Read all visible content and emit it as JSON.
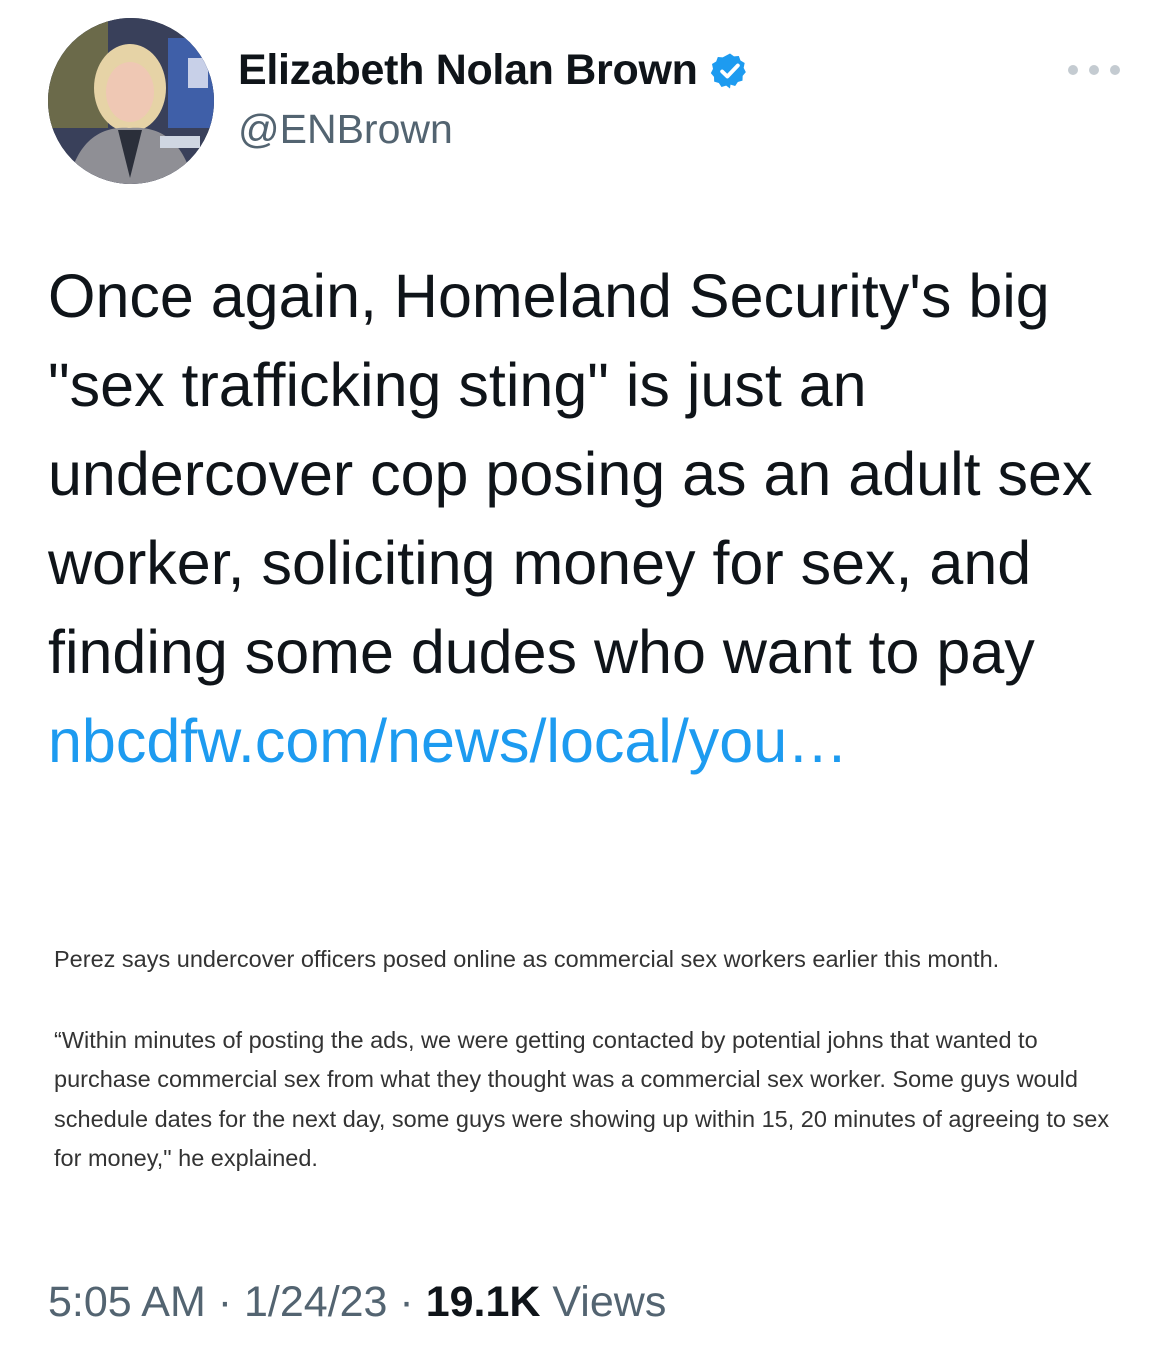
{
  "author": {
    "display_name": "Elizabeth Nolan Brown",
    "handle": "@ENBrown",
    "verified_color": "#1d9bf0"
  },
  "tweet": {
    "text": "Once again, Homeland Security's big \"sex trafficking sting\" is just an undercover cop posing as an adult sex worker, soliciting money for sex, and finding some dudes who want to pay ",
    "link_text": "nbcdfw.com/news/local/you…",
    "link_color": "#1d9bf0"
  },
  "quoted_article": {
    "paragraph_1": "Perez says undercover officers posed online as commercial sex workers earlier this month.",
    "paragraph_2": "“Within minutes of posting the ads, we were getting contacted by potential johns that wanted to purchase commercial sex from what they thought was a commercial sex worker. Some guys would schedule dates for the next day, some guys were showing up within 15, 20 minutes of agreeing to sex for money,\" he explained."
  },
  "meta": {
    "time": "5:05 AM",
    "date": "1/24/23",
    "separator": "·",
    "views_count": "19.1K",
    "views_label": "Views"
  },
  "icons": {
    "more": "more-horizontal-icon",
    "verified": "verified-badge-icon"
  }
}
